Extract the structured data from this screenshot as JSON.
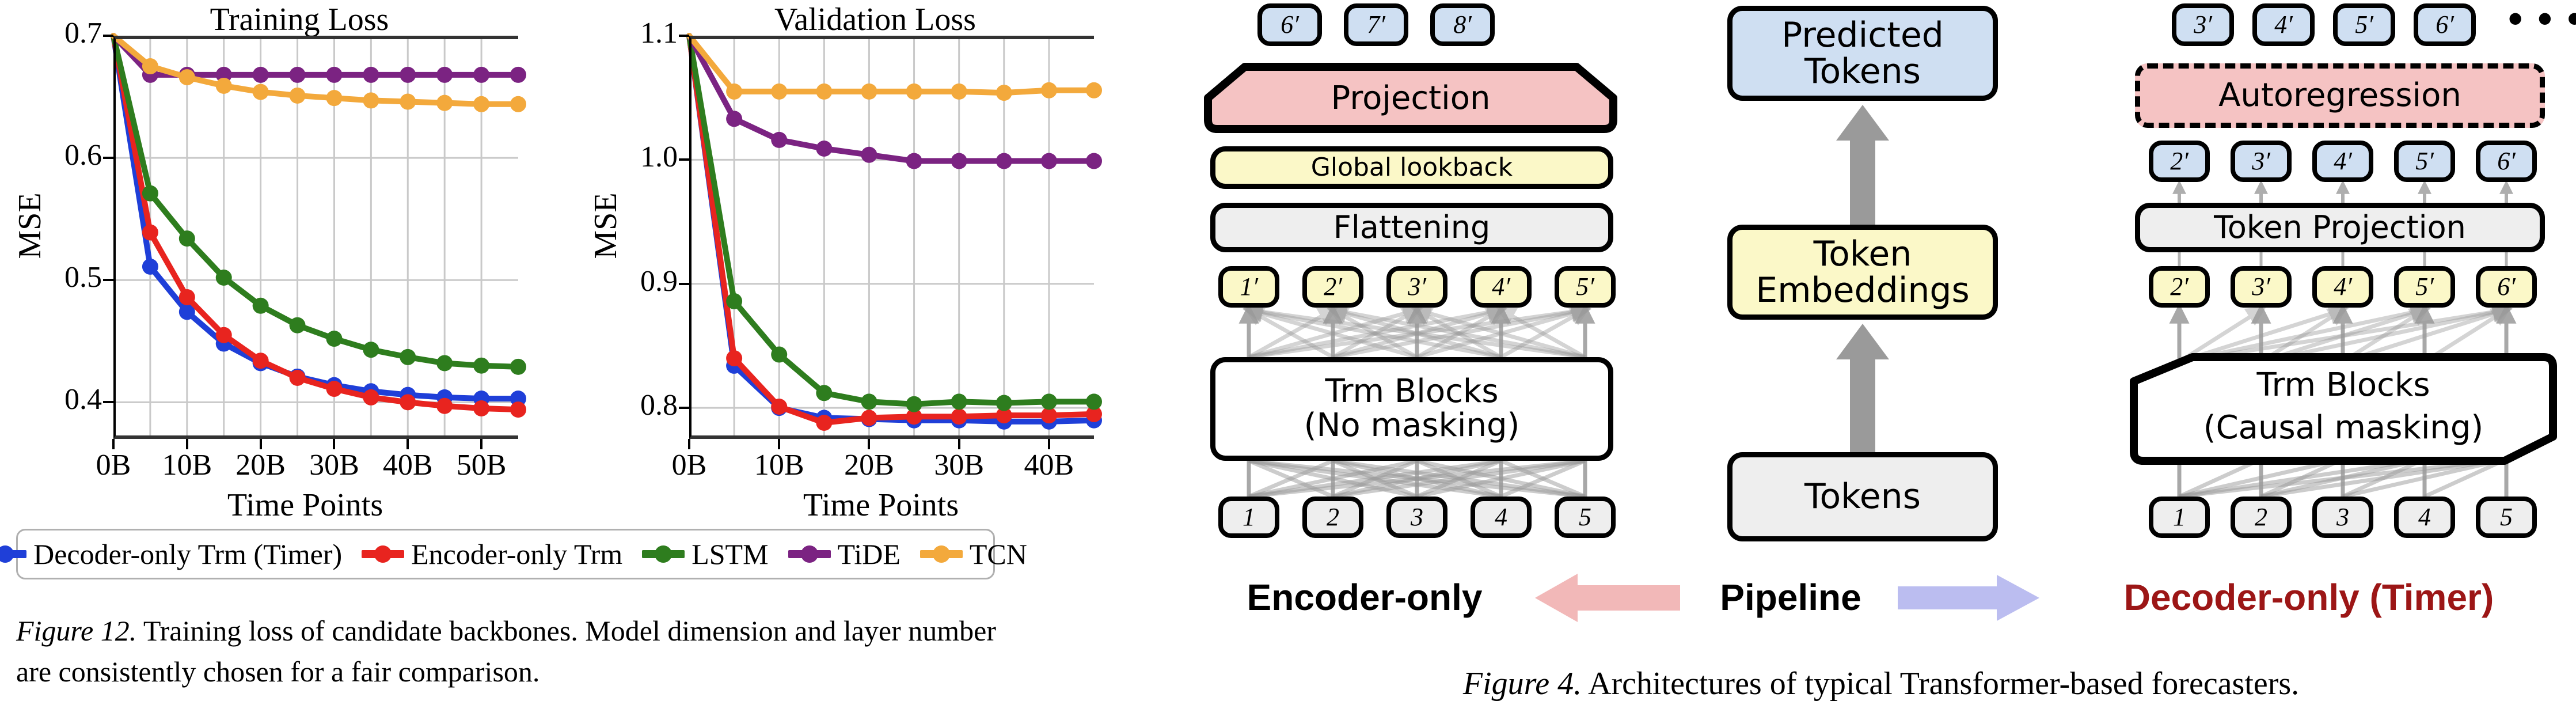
{
  "figure12": {
    "caption_italic": "Figure 12.",
    "caption_rest": " Training loss of candidate backbones. Model dimension and layer number are consistently chosen for a fair comparison.",
    "legend": [
      {
        "label": "Decoder-only Trm (Timer)",
        "color": "#1f3fd8"
      },
      {
        "label": "Encoder-only Trm",
        "color": "#e8241f"
      },
      {
        "label": "LSTM",
        "color": "#2e7d1e"
      },
      {
        "label": "TiDE",
        "color": "#7b2382"
      },
      {
        "label": "TCN",
        "color": "#f3a93c"
      }
    ]
  },
  "chart_data": [
    {
      "type": "line",
      "title": "Training Loss",
      "xlabel": "Time Points",
      "ylabel": "MSE",
      "xticks": [
        "0B",
        "10B",
        "20B",
        "30B",
        "40B",
        "50B"
      ],
      "xtick_values": [
        0,
        10,
        20,
        30,
        40,
        50
      ],
      "yticks": [
        "0.4",
        "0.5",
        "0.6",
        "0.7"
      ],
      "ytick_values": [
        0.4,
        0.5,
        0.6,
        0.7
      ],
      "xlim": [
        0,
        55
      ],
      "ylim": [
        0.37,
        0.7
      ],
      "grid": true,
      "x": [
        0,
        5,
        10,
        15,
        20,
        25,
        30,
        35,
        40,
        45,
        50,
        55
      ],
      "series": [
        {
          "name": "Decoder-only Trm (Timer)",
          "color": "#1f3fd8",
          "values": [
            0.7,
            0.511,
            0.474,
            0.448,
            0.432,
            0.421,
            0.414,
            0.409,
            0.406,
            0.404,
            0.403,
            0.403
          ]
        },
        {
          "name": "Encoder-only Trm",
          "color": "#e8241f",
          "values": [
            0.7,
            0.539,
            0.486,
            0.455,
            0.434,
            0.42,
            0.411,
            0.404,
            0.4,
            0.397,
            0.395,
            0.394
          ]
        },
        {
          "name": "LSTM",
          "color": "#2e7d1e",
          "values": [
            0.7,
            0.571,
            0.534,
            0.502,
            0.479,
            0.463,
            0.452,
            0.443,
            0.437,
            0.432,
            0.43,
            0.429
          ]
        },
        {
          "name": "TiDE",
          "color": "#7b2382",
          "values": [
            0.7,
            0.668,
            0.668,
            0.668,
            0.668,
            0.668,
            0.668,
            0.668,
            0.668,
            0.668,
            0.668,
            0.668
          ]
        },
        {
          "name": "TCN",
          "color": "#f3a93c",
          "values": [
            0.7,
            0.675,
            0.666,
            0.659,
            0.654,
            0.651,
            0.649,
            0.647,
            0.646,
            0.645,
            0.644,
            0.644
          ]
        }
      ]
    },
    {
      "type": "line",
      "title": "Validation Loss",
      "xlabel": "Time Points",
      "ylabel": "MSE",
      "xticks": [
        "0B",
        "10B",
        "20B",
        "30B",
        "40B"
      ],
      "xtick_values": [
        0,
        10,
        20,
        30,
        40
      ],
      "yticks": [
        "0.8",
        "0.9",
        "1.0",
        "1.1"
      ],
      "ytick_values": [
        0.8,
        0.9,
        1.0,
        1.1
      ],
      "xlim": [
        0,
        45
      ],
      "ylim": [
        0.775,
        1.1
      ],
      "grid": true,
      "x": [
        0,
        5,
        10,
        15,
        20,
        25,
        30,
        35,
        40,
        45
      ],
      "series": [
        {
          "name": "Decoder-only Trm (Timer)",
          "color": "#1f3fd8",
          "values": [
            1.1,
            0.834,
            0.8,
            0.792,
            0.791,
            0.79,
            0.79,
            0.789,
            0.789,
            0.79
          ]
        },
        {
          "name": "Encoder-only Trm",
          "color": "#e8241f",
          "values": [
            1.1,
            0.84,
            0.801,
            0.788,
            0.792,
            0.793,
            0.793,
            0.794,
            0.794,
            0.795
          ]
        },
        {
          "name": "LSTM",
          "color": "#2e7d1e",
          "values": [
            1.1,
            0.886,
            0.843,
            0.812,
            0.805,
            0.803,
            0.805,
            0.804,
            0.805,
            0.805
          ]
        },
        {
          "name": "TiDE",
          "color": "#7b2382",
          "values": [
            1.1,
            1.033,
            1.016,
            1.009,
            1.004,
            0.999,
            0.999,
            0.999,
            0.999,
            0.999
          ]
        },
        {
          "name": "TCN",
          "color": "#f3a93c",
          "values": [
            1.1,
            1.055,
            1.055,
            1.055,
            1.055,
            1.055,
            1.055,
            1.054,
            1.056,
            1.056
          ]
        }
      ]
    }
  ],
  "figure4": {
    "caption_italic": "Figure 4.",
    "caption_rest": " Architectures of typical Transformer-based forecasters.",
    "encoder": {
      "output_tokens": [
        "6′",
        "7′",
        "8′"
      ],
      "projection_label": "Projection",
      "global_lookback_label": "Global lookback",
      "flattening_label": "Flattening",
      "hidden_tokens": [
        "1′",
        "2′",
        "3′",
        "4′",
        "5′"
      ],
      "trm_line1": "Trm Blocks",
      "trm_line2": "(No masking)",
      "input_tokens": [
        "1",
        "2",
        "3",
        "4",
        "5"
      ],
      "bottom_label": "Encoder-only"
    },
    "pipeline": {
      "predicted_tokens_label": "Predicted\nTokens",
      "token_embeddings_label": "Token\nEmbeddings",
      "tokens_label": "Tokens",
      "bottom_label": "Pipeline"
    },
    "decoder": {
      "output_tokens": [
        "3′",
        "4′",
        "5′",
        "6′"
      ],
      "ellipsis": "•••",
      "autoregression_label": "Autoregression",
      "projected_tokens": [
        "2′",
        "3′",
        "4′",
        "5′",
        "6′"
      ],
      "token_projection_label": "Token Projection",
      "hidden_tokens": [
        "2′",
        "3′",
        "4′",
        "5′",
        "6′"
      ],
      "trm_line1": "Trm Blocks",
      "trm_line2": "(Causal masking)",
      "input_tokens": [
        "1",
        "2",
        "3",
        "4",
        "5"
      ],
      "bottom_label": "Decoder-only (Timer)",
      "bottom_label_color": "#9c1616"
    },
    "colors": {
      "blue_fill": "#cfdff2",
      "yellow_fill": "#fbf8c8",
      "grey_fill": "#eeeeee",
      "pink_fill": "#f5c3c3",
      "arrow_grey": "#9a9a9a",
      "left_arrow": "#f2b8b8",
      "right_arrow": "#bbbdf0"
    }
  }
}
